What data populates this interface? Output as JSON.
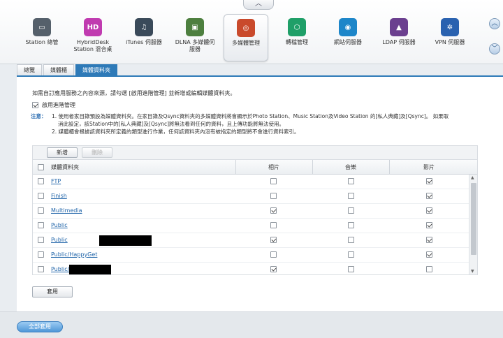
{
  "apps": [
    {
      "label": "Station 總管",
      "icon": "station-manager-icon",
      "color": "#55606b",
      "glyph": "▭"
    },
    {
      "label": "HybridDesk\nStation 混合桌",
      "icon": "hybriddesk-icon",
      "color": "#c03bb0",
      "glyph": "HD"
    },
    {
      "label": "iTunes 伺服器",
      "icon": "itunes-server-icon",
      "color": "#3a4a5a",
      "glyph": "♫"
    },
    {
      "label": "DLNA 多媒體伺\n服器",
      "icon": "dlna-server-icon",
      "color": "#4d7f3f",
      "glyph": "▣"
    },
    {
      "label": "多媒體管理",
      "icon": "multimedia-icon",
      "color": "#c94a2c",
      "glyph": "◎"
    },
    {
      "label": "轉檔管理",
      "icon": "transcode-icon",
      "color": "#1f9f68",
      "glyph": "⬡"
    },
    {
      "label": "網站伺服器",
      "icon": "web-server-icon",
      "color": "#1d86c9",
      "glyph": "◉"
    },
    {
      "label": "LDAP 伺服器",
      "icon": "ldap-server-icon",
      "color": "#6b3f8f",
      "glyph": "▲"
    },
    {
      "label": "VPN 伺服器",
      "icon": "vpn-server-icon",
      "color": "#2a62b0",
      "glyph": "✲"
    }
  ],
  "tabs": [
    "總覽",
    "媒體櫃",
    "媒體資料夾"
  ],
  "intro": "如需自訂應用服務之內容來源，請勾選 [啟用進階管理] 並新增或編輯媒體資料夾。",
  "advanced": {
    "label": "啟用進階管理",
    "checked": true
  },
  "note": {
    "label": "注意：",
    "line1": "1. 使用者家目錄預設為媒體資料夾。在家目錄及Qsync資料夾的多媒體資料將會顯示於Photo Station、Music Station及Video Station 的[私人典藏]及[Qsync]。 如果取",
    "line2": "消此設定，該Station中的[私人典藏]及[Qsync]將無法看到任何的資料，且上傳功能將無法使用。",
    "line3": "2. 媒體櫃會根據該資料夾所定義的類型進行作業，任何該資料夾內沒有被指定的類型將不會進行資料索引。"
  },
  "toolbar": {
    "add": "新增",
    "delete": "刪除"
  },
  "table": {
    "headers": [
      "媒體資料夾",
      "相片",
      "音樂",
      "影片"
    ],
    "rows": [
      {
        "name": "FTP",
        "photo": false,
        "music": false,
        "video": true
      },
      {
        "name": "Finish",
        "photo": false,
        "music": false,
        "video": true
      },
      {
        "name": "Multimedia",
        "photo": true,
        "music": false,
        "video": true
      },
      {
        "name": "Public",
        "photo": false,
        "music": false,
        "video": true
      },
      {
        "name": "Public",
        "photo": true,
        "music": false,
        "video": true
      },
      {
        "name": "Public/HappyGet",
        "photo": false,
        "music": false,
        "video": true
      },
      {
        "name": "Public/",
        "photo": true,
        "music": false,
        "video": false
      }
    ]
  },
  "apply": "套用",
  "apply_all": "全部套用",
  "colors": {
    "accent": "#2e7ab8",
    "link": "#2266aa"
  }
}
